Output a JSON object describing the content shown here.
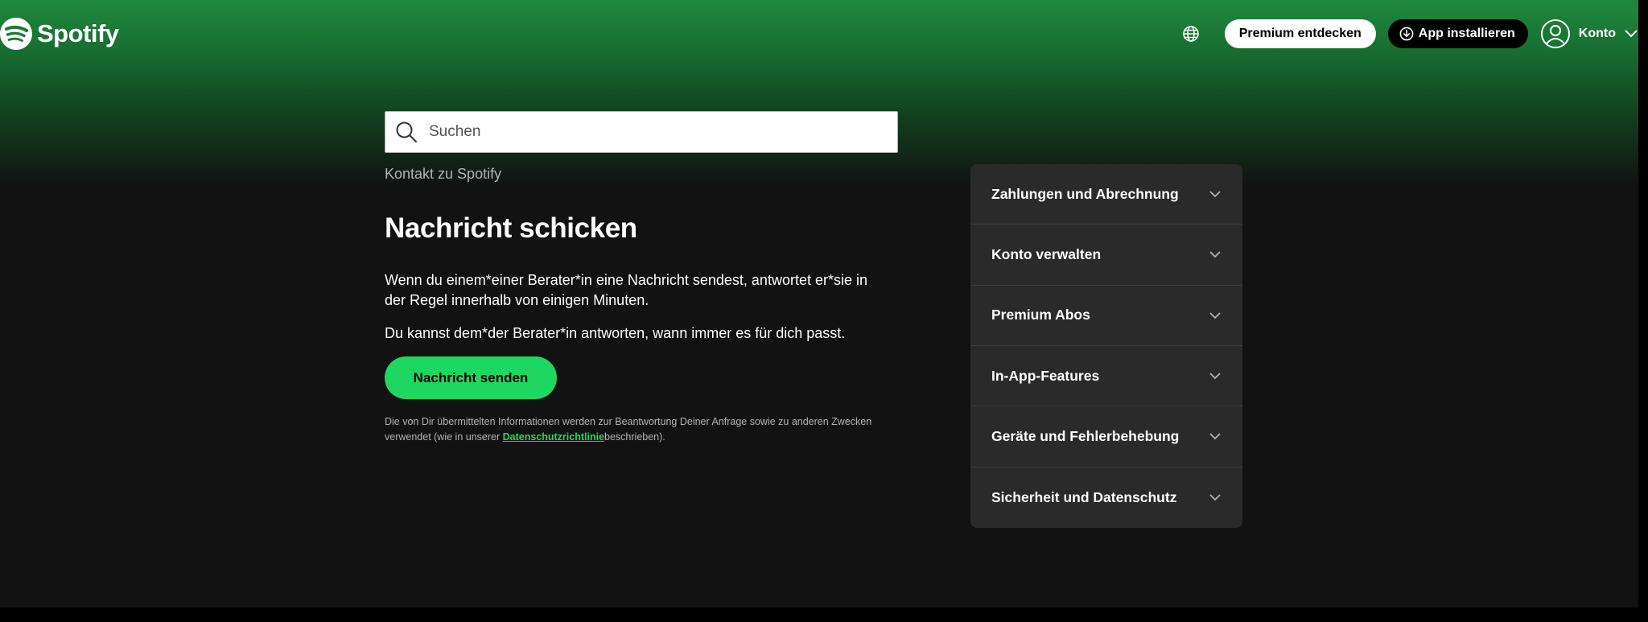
{
  "header": {
    "logo_text": "Spotify",
    "premium_button": "Premium entdecken",
    "install_button": "App installieren",
    "account_label": "Konto",
    "icons": [
      "spotify-logo-icon",
      "globe-icon",
      "download-icon",
      "user-avatar-icon",
      "chevron-down-icon"
    ]
  },
  "search": {
    "placeholder": "Suchen"
  },
  "breadcrumb": "Kontakt zu Spotify",
  "main": {
    "title": "Nachricht schicken",
    "paragraph1": "Wenn du einem*einer Berater*in eine Nachricht sendest, antwortet er*sie in der Regel innerhalb von einigen Minuten.",
    "paragraph2": "Du kannst dem*der Berater*in antworten, wann immer es für dich passt.",
    "send_button": "Nachricht senden",
    "disclaimer_before": "Die von Dir übermittelten Informationen werden zur Beantwortung Deiner Anfrage sowie zu anderen Zwecken verwendet (wie in unserer ",
    "disclaimer_link": "Datenschutzrichtlinie",
    "disclaimer_after": "beschrieben)."
  },
  "sidebar": {
    "items": [
      {
        "label": "Zahlungen und Abrechnung"
      },
      {
        "label": "Konto verwalten"
      },
      {
        "label": "Premium Abos"
      },
      {
        "label": "In-App-Features"
      },
      {
        "label": "Geräte und Fehlerbehebung"
      },
      {
        "label": "Sicherheit und Datenschutz"
      }
    ]
  },
  "colors": {
    "brand_green": "#1ed760",
    "background": "#121212",
    "panel": "#2a2a2a",
    "gradient_top": "#1f8a3d"
  }
}
